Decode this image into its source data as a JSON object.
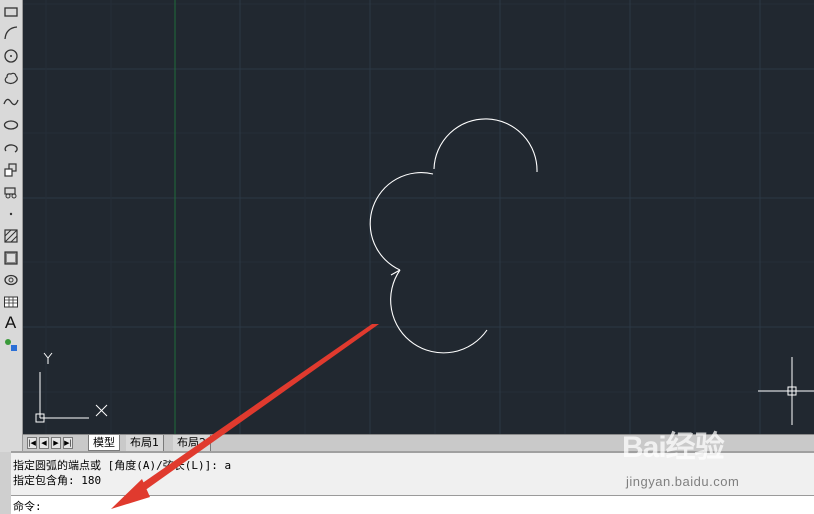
{
  "toolbar": {
    "tools": [
      {
        "icon": "rectangle-icon"
      },
      {
        "icon": "arc-icon"
      },
      {
        "icon": "circle-icon"
      },
      {
        "icon": "revision-cloud-icon"
      },
      {
        "icon": "spline-icon"
      },
      {
        "icon": "ellipse-icon"
      },
      {
        "icon": "ellipse-arc-icon"
      },
      {
        "icon": "insert-block-icon"
      },
      {
        "icon": "make-block-icon"
      },
      {
        "icon": "point-icon"
      },
      {
        "icon": "hatch-icon"
      },
      {
        "icon": "gradient-icon"
      },
      {
        "icon": "region-icon"
      },
      {
        "icon": "table-icon"
      },
      {
        "icon": "multiline-text-icon",
        "label": "A"
      },
      {
        "icon": "add-selected-icon"
      }
    ]
  },
  "ucs": {
    "y_label": "Y",
    "x_label": "X"
  },
  "tabs": {
    "model": "模型",
    "layout1": "布局1",
    "layout2": "布局2"
  },
  "command": {
    "history_line1": "指定圆弧的端点或 [角度(A)/弦长(L)]: a",
    "history_line2": "指定包含角: 180",
    "prompt": "命令:"
  },
  "watermark": {
    "logo": "Bai经验",
    "brand": "经验",
    "url": "jingyan.baidu.com"
  },
  "colors": {
    "canvas": "#212830",
    "grid": "#2c3845",
    "y_axis": "#1f6b3a",
    "geometry": "#ffffff",
    "annotation_arrow": "#e03a2e"
  }
}
